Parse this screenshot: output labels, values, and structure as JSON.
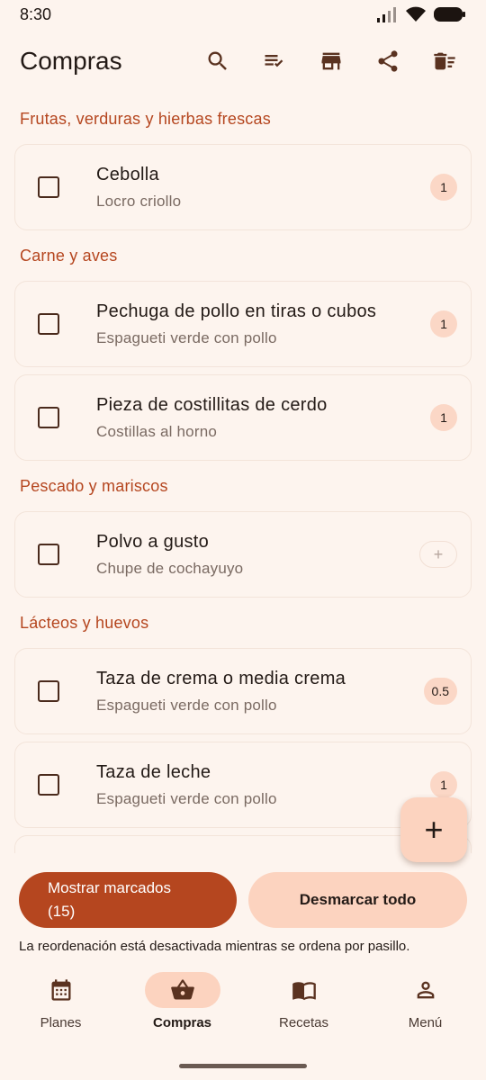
{
  "status": {
    "time": "8:30"
  },
  "header": {
    "title": "Compras"
  },
  "sections": [
    {
      "title": "Frutas, verduras y hierbas frescas",
      "items": [
        {
          "name": "Cebolla",
          "recipe": "Locro criollo",
          "qty": "1"
        }
      ]
    },
    {
      "title": "Carne y aves",
      "items": [
        {
          "name": "Pechuga de pollo en tiras o cubos",
          "recipe": "Espagueti verde con pollo",
          "qty": "1"
        },
        {
          "name": "Pieza de costillitas de cerdo",
          "recipe": "Costillas al horno",
          "qty": "1"
        }
      ]
    },
    {
      "title": "Pescado y mariscos",
      "items": [
        {
          "name": "Polvo a gusto",
          "recipe": "Chupe de cochayuyo",
          "qty": "+"
        }
      ]
    },
    {
      "title": "Lácteos y huevos",
      "items": [
        {
          "name": "Taza de crema o media crema",
          "recipe": "Espagueti verde con pollo",
          "qty": "0.5"
        },
        {
          "name": "Taza de leche",
          "recipe": "Espagueti verde con pollo",
          "qty": "1"
        }
      ]
    }
  ],
  "fab": {
    "label": "+"
  },
  "actions": {
    "show_checked": "Mostrar marcados",
    "show_checked_count": "(15)",
    "uncheck_all": "Desmarcar todo"
  },
  "info": "La reordenación está desactivada mientras se ordena por pasillo.",
  "nav": {
    "plans": "Planes",
    "shopping": "Compras",
    "recipes": "Recetas",
    "menu": "Menú"
  },
  "colors": {
    "accent": "#b5461f",
    "tonal": "#fcd3bf",
    "background": "#fdf4ee"
  }
}
